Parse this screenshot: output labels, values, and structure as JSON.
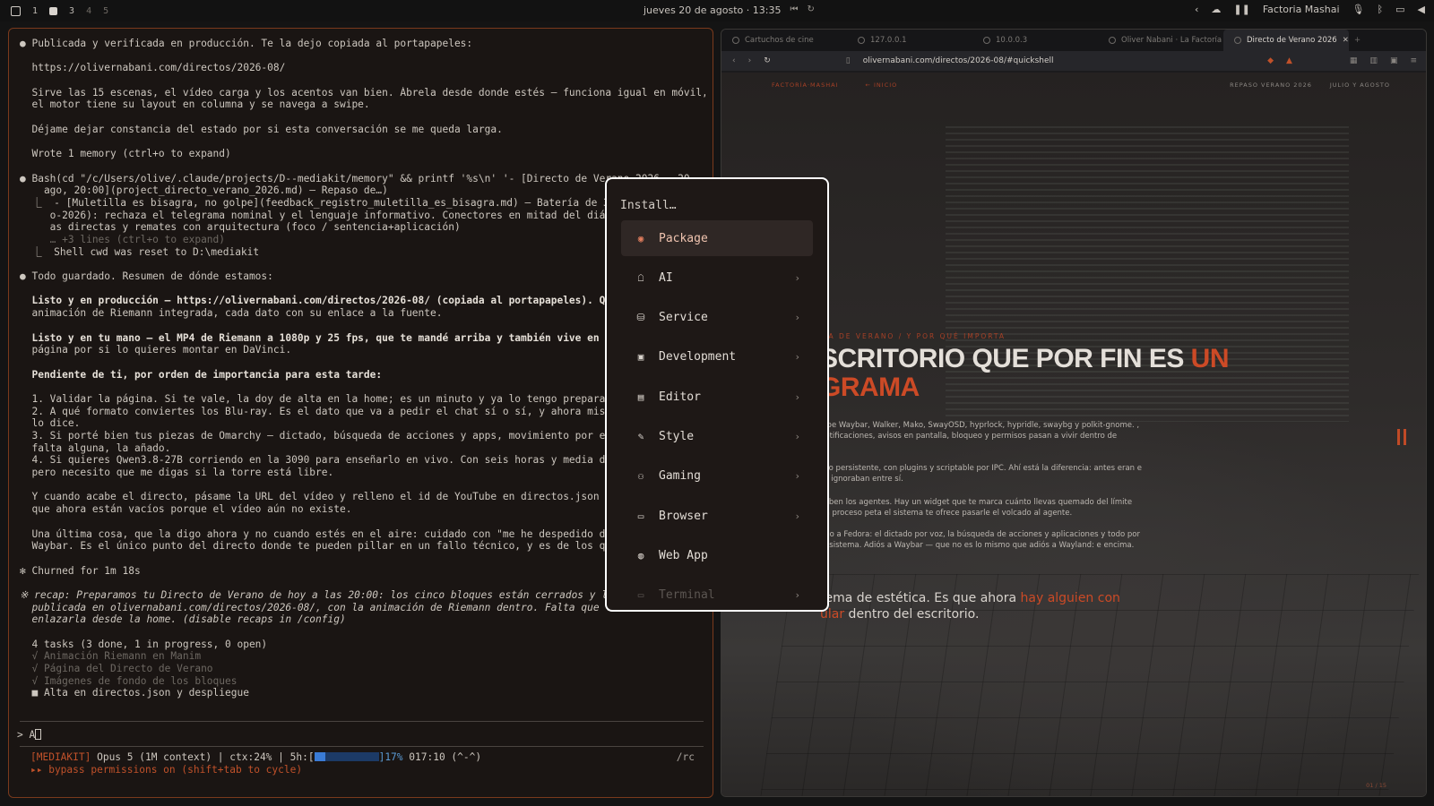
{
  "topbar": {
    "workspaces": [
      "1",
      "3",
      "4",
      "5"
    ],
    "datetime": "jueves 20 de agosto · 13:35",
    "tray_label": "Factoria Mashai"
  },
  "terminal": {
    "lines": [
      "● Publicada y verificada en producción. Te la dejo copiada al portapapeles:",
      "",
      "  https://olivernabani.com/directos/2026-08/",
      "",
      "  Sirve las 15 escenas, el vídeo carga y los acentos van bien. Ábrela desde donde estés — funciona igual en móvil,",
      "  el motor tiene su layout en columna y se navega a swipe.",
      "",
      "  Déjame dejar constancia del estado por si esta conversación se me queda larga.",
      "",
      "  Wrote 1 memory (ctrl+o to expand)",
      "",
      "● Bash(cd \"/c/Users/olive/.claude/projects/D--mediakit/memory\" && printf '%s\\n' '- [Directo de Verano 2026 — 20",
      "    ago, 20:00](project_directo_verano_2026.md) — Repaso de…)",
      "  ⎿  - [Muletilla es bisagra, no golpe](feedback_registro_muletilla_es_bisagra.md) — Batería de 30",
      "     o-2026): rechaza el telegrama nominal y el lenguaje informativo. Conectores en mitad del diálo",
      "     as directas y remates con arquitectura (foco / sentencia+aplicación)",
      "     … +3 lines (ctrl+o to expand)",
      "  ⎿  Shell cwd was reset to D:\\mediakit",
      "",
      "● Todo guardado. Resumen de dónde estamos:",
      "",
      "  Listo y en producción — https://olivernabani.com/directos/2026-08/ (copiada al portapapeles). Qu",
      "  animación de Riemann integrada, cada dato con su enlace a la fuente.",
      "",
      "  Listo y en tu mano — el MP4 de Riemann a 1080p y 25 fps, que te mandé arriba y también vive en la",
      "  página por si lo quieres montar en DaVinci.",
      "",
      "  Pendiente de ti, por orden de importancia para esta tarde:",
      "",
      "  1. Validar la página. Si te vale, la doy de alta en la home; es un minuto y ya lo tengo preparado",
      "  2. A qué formato conviertes los Blu-ray. Es el dato que va a pedir el chat sí o sí, y ahora mismo",
      "  lo dice.",
      "  3. Si porté bien tus piezas de Omarchy — dictado, búsqueda de acciones y apps, movimiento por el",
      "  falta alguna, la añado.",
      "  4. Si quieres Qwen3.8-27B corriendo en la 3090 para enseñarlo en vivo. Con seis horas y media da",
      "  pero necesito que me digas si la torre está libre.",
      "",
      "  Y cuando acabe el directo, pásame la URL del vídeo y relleno el id de YouTube en directos.json y",
      "  que ahora están vacíos porque el vídeo aún no existe.",
      "",
      "  Una última cosa, que la digo ahora y no cuando estés en el aire: cuidado con \"me he despedido de",
      "  Waybar. Es el único punto del directo donde te pueden pillar en un fallo técnico, y es de los que",
      "",
      "✻ Churned for 1m 18s",
      "",
      "※ recap: Preparamos tu Directo de Verano de hoy a las 20:00: los cinco bloques están cerrados y la",
      "  publicada en olivernabani.com/directos/2026-08/, con la animación de Riemann dentro. Falta que la",
      "  enlazarla desde la home. (disable recaps in /config)",
      "",
      "  4 tasks (3 done, 1 in progress, 0 open)",
      "  √ Animación Riemann en Manim",
      "  √ Página del Directo de Verano",
      "  √ Imágenes de fondo de los bloques",
      "  ■ Alta en directos.json y despliegue"
    ],
    "prompt": "> A",
    "status_tag": "[MEDIAKIT]",
    "status_text": " Opus 5 (1M context) | ctx:24% | 5h:[",
    "status_pct": "]17%",
    "status_time": " 017:10 (^-^)",
    "usage_fraction": 0.17,
    "status_cmd": "/rc",
    "status2": "▸▸ bypass permissions on (shift+tab to cycle)"
  },
  "browser": {
    "tabs": [
      "Cartuchos de cine",
      "127.0.0.1",
      "10.0.0.3",
      "Oliver Nabani · La Factoría",
      "Directo de Verano 2026"
    ],
    "url": "olivernabani.com/directos/2026-08/#quickshell",
    "site_nav_left": [
      "FACTORÍA·MASHAI",
      "← INICIO"
    ],
    "site_nav_right": [
      "REPASO VERANO 2026",
      "JULIO Y AGOSTO"
    ],
    "eyebrow": "…A DE VERANO / Y POR QUÉ IMPORTA",
    "hero_line1": "SCRITORIO QUE POR FIN ES ",
    "hero_accent": "UN",
    "hero_line2": "GRAMA",
    "para1": "olpe Waybar, Walker, Mako, SwayOSD, hyprlock, hypridle, swaybg y polkit-gnome. , notificaciones, avisos en pantalla, bloqueo y permisos pasan a vivir dentro de",
    "para2": "eso persistente, con plugins y scriptable por IPC. Ahí está la diferencia: antes eran e se ignoraban entre sí.",
    "para3": "caben los agentes. Hay un widget que te marca cuánto llevas quemado del límite un proceso peta el sistema te ofrece pasarle el volcado al agente.",
    "para4": "ado a Fedora: el dictado por voz, la búsqueda de acciones y aplicaciones y todo por el sistema. Adiós a Waybar — que no es lo mismo que adiós a Wayland: e encima.",
    "lead_text": "tema de estética. Es que ahora ",
    "lead_accent": "hay alguien con",
    "lead_accent2": "ular",
    "lead_tail": " dentro del escritorio.",
    "pager": "01 / 15"
  },
  "menu": {
    "title": "Install…",
    "items": [
      {
        "label": "Package",
        "icon": "package-icon",
        "glyph": "◉",
        "has_submenu": false,
        "selected": true
      },
      {
        "label": "AI",
        "icon": "robot-icon",
        "glyph": "☖",
        "has_submenu": true
      },
      {
        "label": "Service",
        "icon": "server-icon",
        "glyph": "⛁",
        "has_submenu": true
      },
      {
        "label": "Development",
        "icon": "code-icon",
        "glyph": "▣",
        "has_submenu": true
      },
      {
        "label": "Editor",
        "icon": "document-icon",
        "glyph": "▤",
        "has_submenu": true
      },
      {
        "label": "Style",
        "icon": "brush-icon",
        "glyph": "✎",
        "has_submenu": true
      },
      {
        "label": "Gaming",
        "icon": "gamepad-icon",
        "glyph": "⚇",
        "has_submenu": true
      },
      {
        "label": "Browser",
        "icon": "window-icon",
        "glyph": "▭",
        "has_submenu": true
      },
      {
        "label": "Web App",
        "icon": "globe-icon",
        "glyph": "◍",
        "has_submenu": false
      },
      {
        "label": "Terminal",
        "icon": "terminal-icon",
        "glyph": "▭",
        "has_submenu": true
      }
    ]
  },
  "colors": {
    "accent": "#cc4a26",
    "terminal_border": "#7a3a1c",
    "menu_border": "#ffffff",
    "selected_bg": "#2f2725"
  }
}
